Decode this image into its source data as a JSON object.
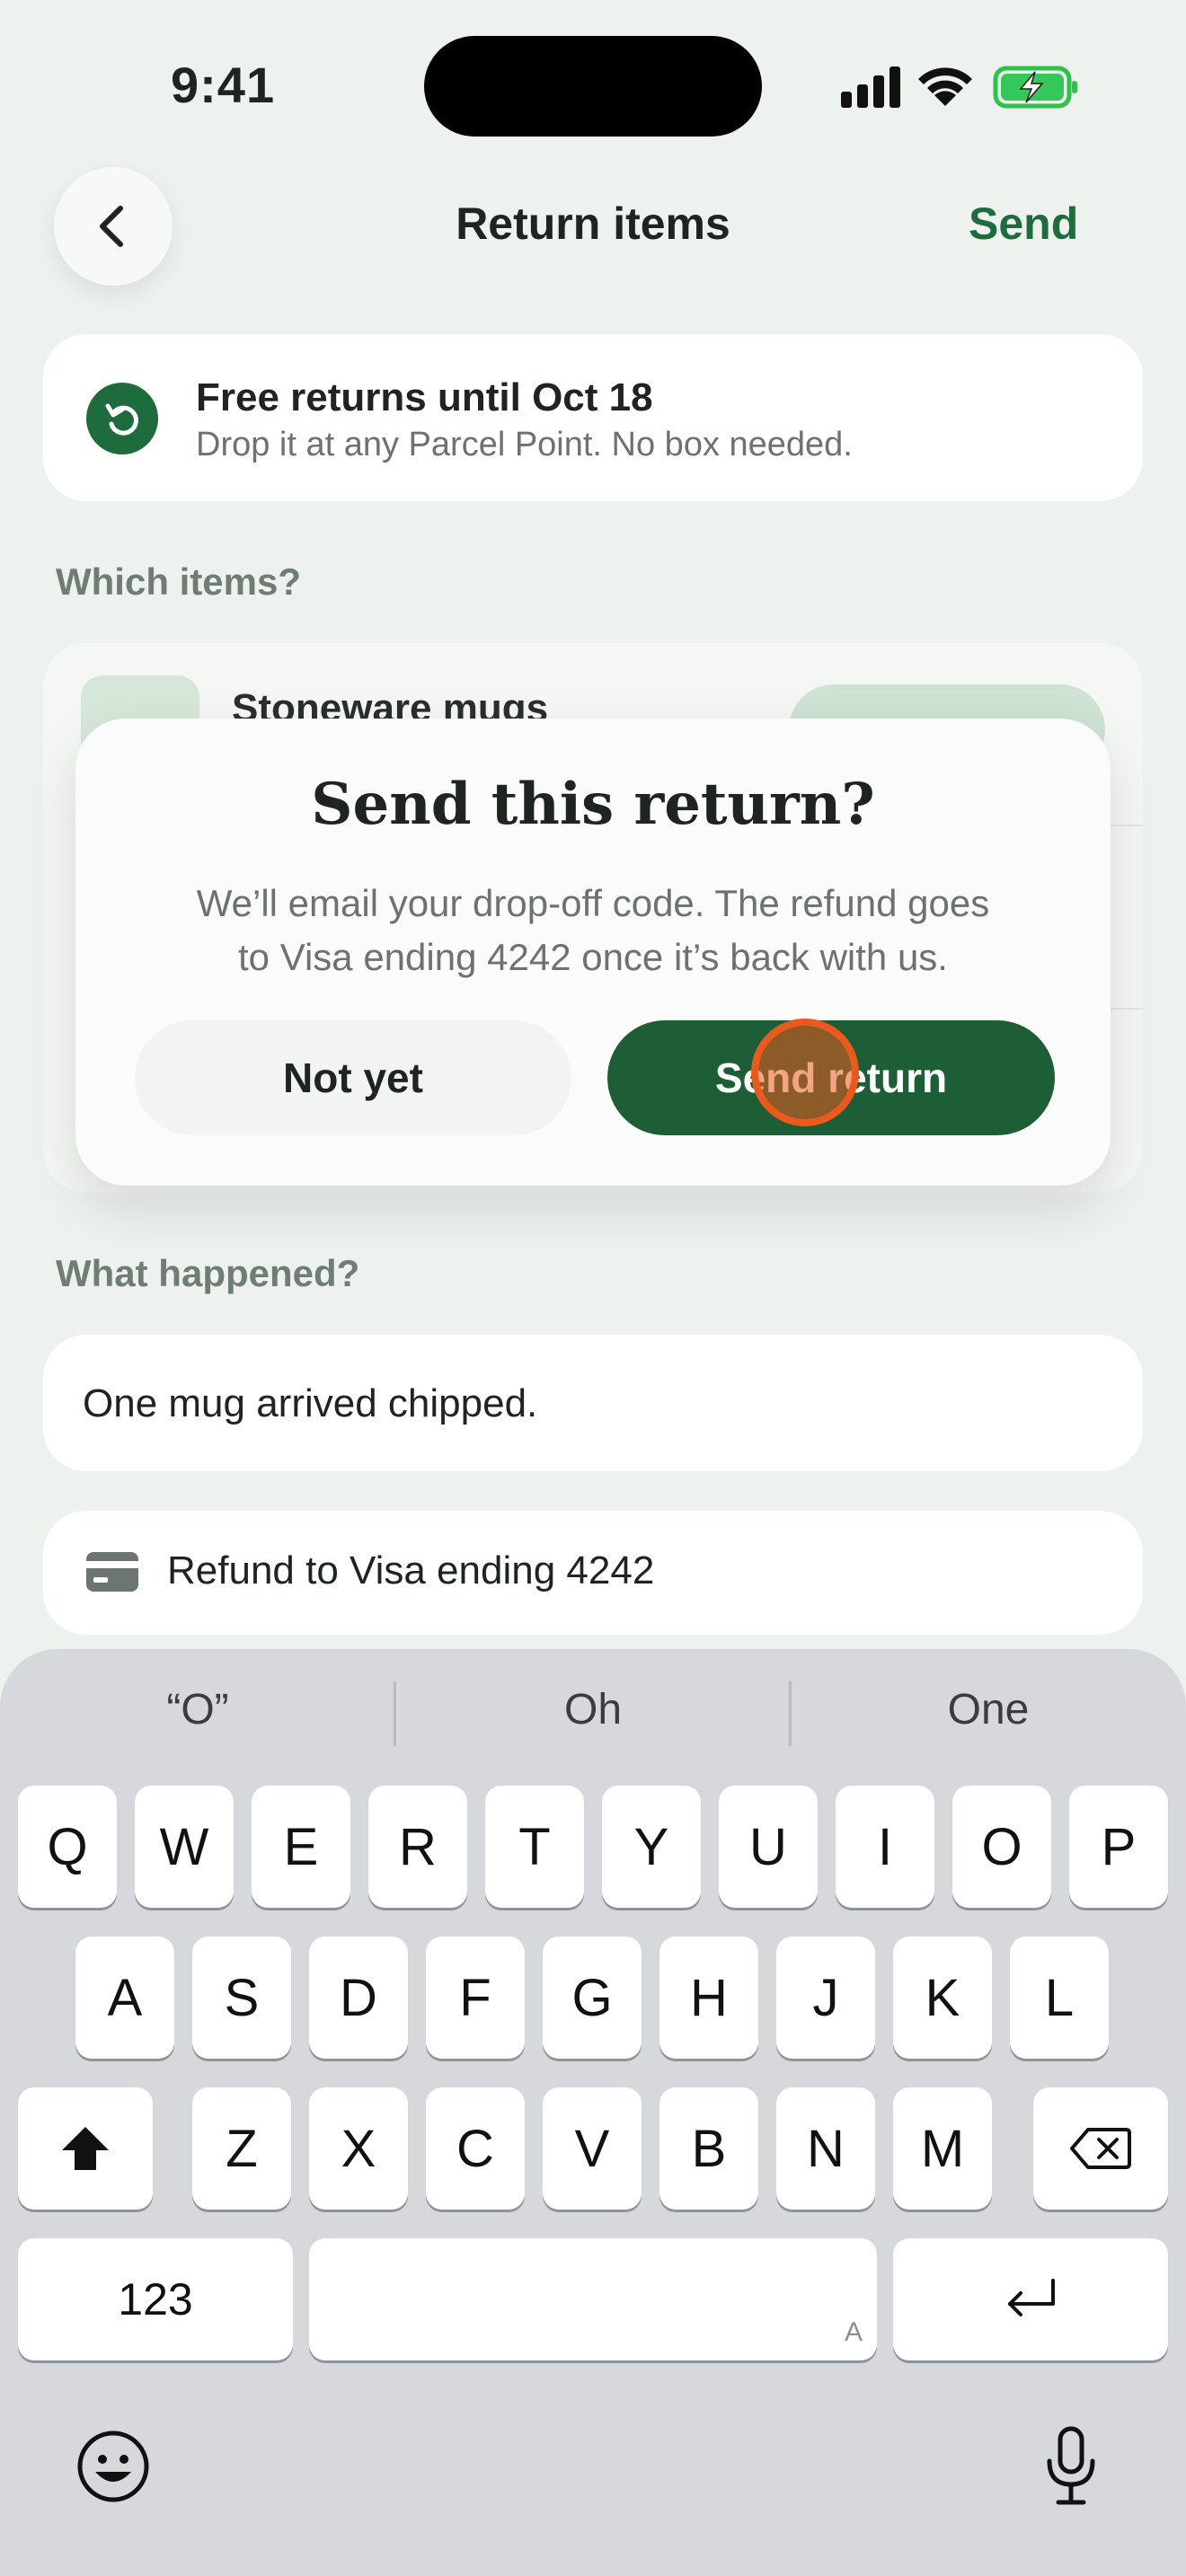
{
  "status_bar": {
    "time": "9:41"
  },
  "nav": {
    "title": "Return items",
    "action": "Send"
  },
  "banner": {
    "title": "Free returns until Oct 18",
    "subtitle": "Drop it at any Parcel Point. No box needed."
  },
  "items_section": {
    "label": "Which items?",
    "first_item": "Stoneware mugs"
  },
  "reason_section": {
    "label": "What happened?",
    "value": "One mug arrived chipped."
  },
  "refund": {
    "text": "Refund to Visa ending 4242"
  },
  "modal": {
    "title": "Send this return?",
    "body_line1": "We’ll email your drop-off code. The refund goes",
    "body_line2": "to Visa ending 4242 once it’s back with us.",
    "cancel": "Not yet",
    "confirm": "Send return"
  },
  "keyboard": {
    "suggestions": [
      "“O”",
      "Oh",
      "One"
    ],
    "row1": [
      "Q",
      "W",
      "E",
      "R",
      "T",
      "Y",
      "U",
      "I",
      "O",
      "P"
    ],
    "row2": [
      "A",
      "S",
      "D",
      "F",
      "G",
      "H",
      "J",
      "K",
      "L"
    ],
    "row3": [
      "Z",
      "X",
      "C",
      "V",
      "B",
      "N",
      "M"
    ],
    "numbers_key": "123",
    "space_hint": "A"
  },
  "colors": {
    "accent": "#1e6b3e",
    "confirm_button": "#1d5e36",
    "tap_indicator": "#ea5a1e"
  }
}
